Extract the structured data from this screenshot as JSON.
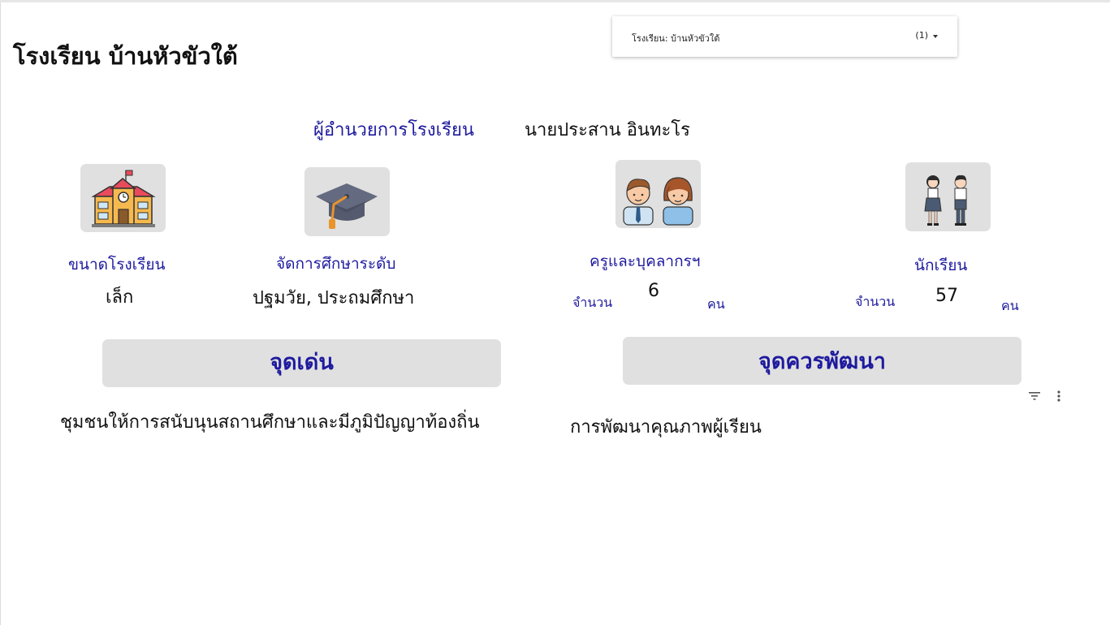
{
  "page": {
    "title": "โรงเรียน บ้านหัวขัวใต้"
  },
  "filter": {
    "label": "โรงเรียน: บ้านหัวขัวใต้",
    "count": "(1)"
  },
  "director": {
    "label": "ผู้อำนวยการโรงเรียน",
    "name": "นายประสาน อินทะโร"
  },
  "school_size": {
    "label": "ขนาดโรงเรียน",
    "value": "เล็ก"
  },
  "education_level": {
    "label": "จัดการศึกษาระดับ",
    "value": "ปฐมวัย, ประถมศึกษา"
  },
  "teachers": {
    "label": "ครูและบุคลากรฯ",
    "count_prefix": "จำนวน",
    "count": "6",
    "unit": "คน"
  },
  "students": {
    "label": "นักเรียน",
    "count_prefix": "จำนวน",
    "count": "57",
    "unit": "คน"
  },
  "strengths": {
    "heading": "จุดเด่น",
    "text": "ชุมชนให้การสนับนุนสถานศึกษาและมีภูมิปัญญาท้องถิ่น"
  },
  "improvements": {
    "heading": "จุดควรพัฒนา",
    "text": "การพัฒนาคุณภาพผู้เรียน"
  },
  "icons": {
    "school": "school-building-icon",
    "graduation": "graduation-cap-icon",
    "teachers": "teachers-icon",
    "students": "students-icon",
    "filter": "filter-icon",
    "more": "more-vert-icon"
  },
  "colors": {
    "accent": "#1e1a9e",
    "card": "#e0e0e0"
  }
}
